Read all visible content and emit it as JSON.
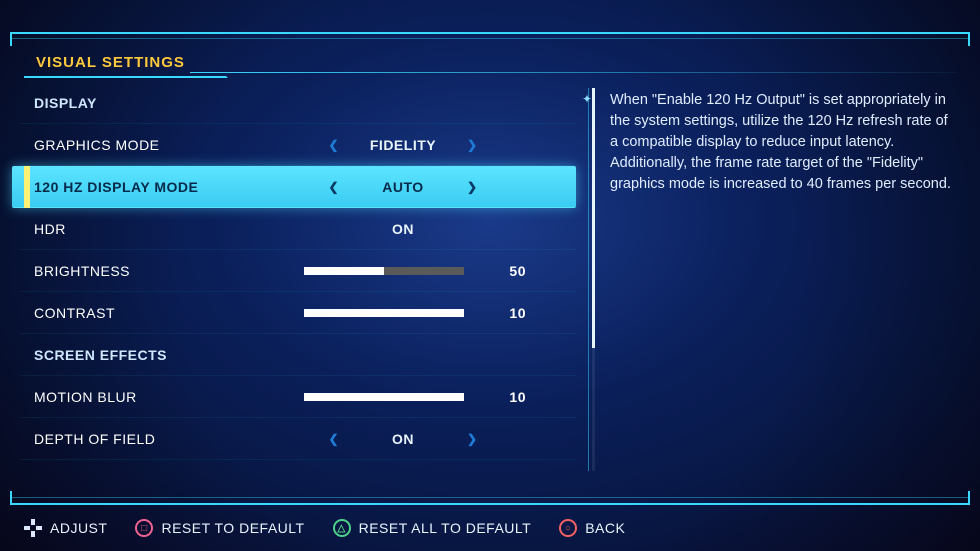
{
  "title": "VISUAL SETTINGS",
  "sections": {
    "display_header": "DISPLAY",
    "effects_header": "SCREEN EFFECTS"
  },
  "rows": {
    "graphics_mode": {
      "label": "GRAPHICS MODE",
      "value": "FIDELITY"
    },
    "display_120": {
      "label": "120 HZ DISPLAY MODE",
      "value": "AUTO"
    },
    "hdr": {
      "label": "HDR",
      "value": "ON"
    },
    "brightness": {
      "label": "BRIGHTNESS",
      "value": "50",
      "pct": 50
    },
    "contrast": {
      "label": "CONTRAST",
      "value": "10",
      "pct": 100
    },
    "motion_blur": {
      "label": "MOTION BLUR",
      "value": "10",
      "pct": 100
    },
    "depth_of_field": {
      "label": "DEPTH OF FIELD",
      "value": "ON"
    }
  },
  "description": "When \"Enable 120 Hz Output\" is set appropriately in the system settings, utilize the 120 Hz refresh rate of a compatible display to reduce input latency. Additionally, the frame rate target of the \"Fidelity\" graphics mode is increased to 40 frames per second.",
  "footer": {
    "adjust": "ADJUST",
    "reset": "RESET TO DEFAULT",
    "reset_all": "RESET ALL TO DEFAULT",
    "back": "BACK"
  },
  "colors": {
    "square": "#f06292",
    "triangle": "#4dd08a",
    "circle": "#f06262",
    "accent": "#39d8ff",
    "highlight": "#ffc93c"
  }
}
